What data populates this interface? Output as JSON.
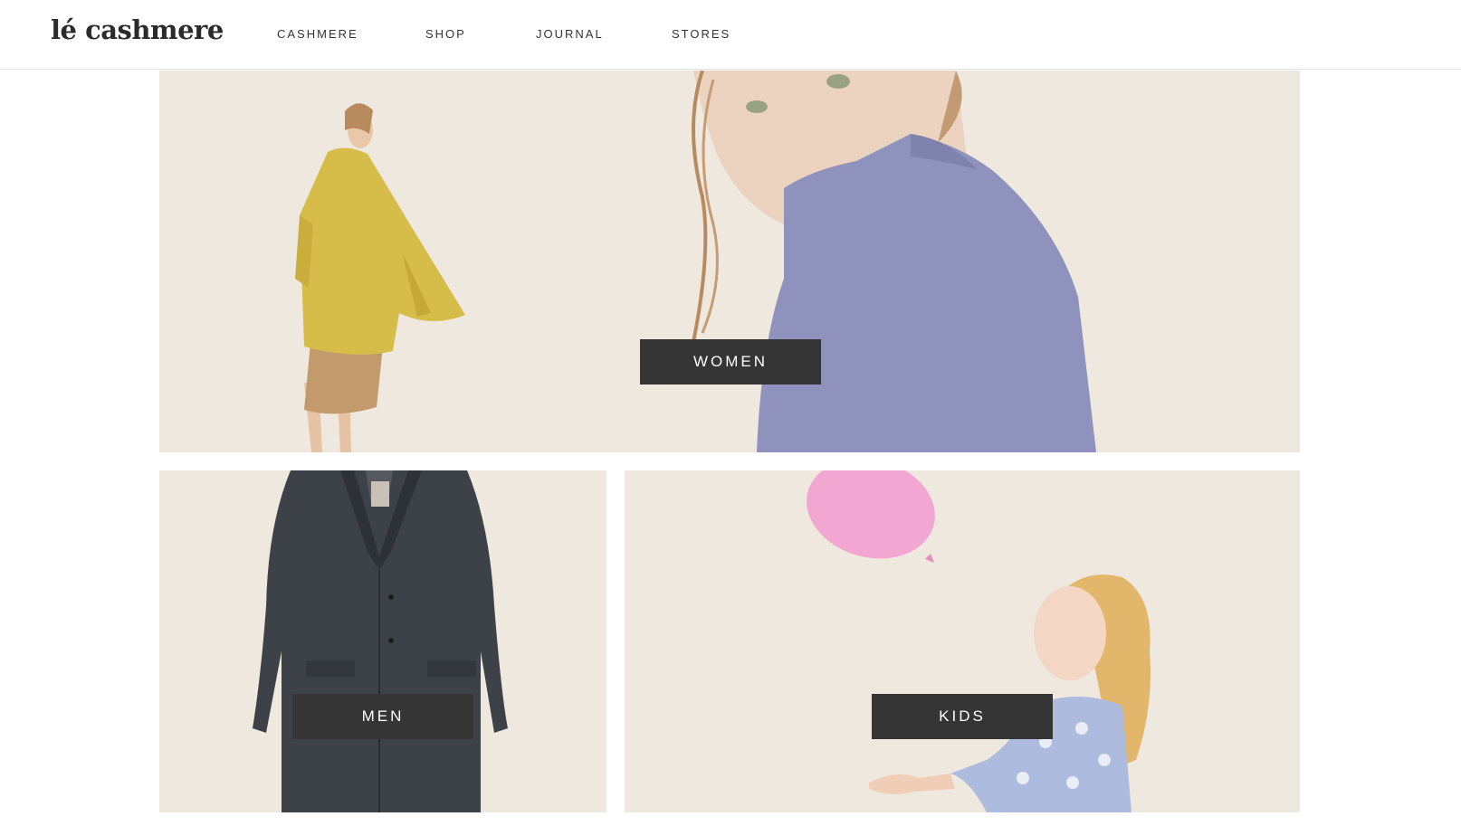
{
  "brand": {
    "logo_text": "lé cashmere"
  },
  "nav": {
    "items": [
      {
        "label": "CASHMERE"
      },
      {
        "label": "SHOP"
      },
      {
        "label": "JOURNAL"
      },
      {
        "label": "STORES"
      }
    ]
  },
  "tiles": {
    "women": {
      "label": "WOMEN"
    },
    "men": {
      "label": "MEN"
    },
    "kids": {
      "label": "KIDS"
    }
  },
  "colors": {
    "tile_background": "#efe8de",
    "button_background": "#353535",
    "button_text": "#ffffff",
    "yellow_coat": "#d6bd4a",
    "lavender_sweater": "#8f92bd",
    "charcoal_coat": "#3d4249",
    "pink_balloon": "#f2a7d3"
  },
  "icons": [
    "woman-yellow-coat-photo",
    "woman-lavender-sweater-photo",
    "charcoal-coat-photo",
    "child-with-balloon-photo"
  ]
}
